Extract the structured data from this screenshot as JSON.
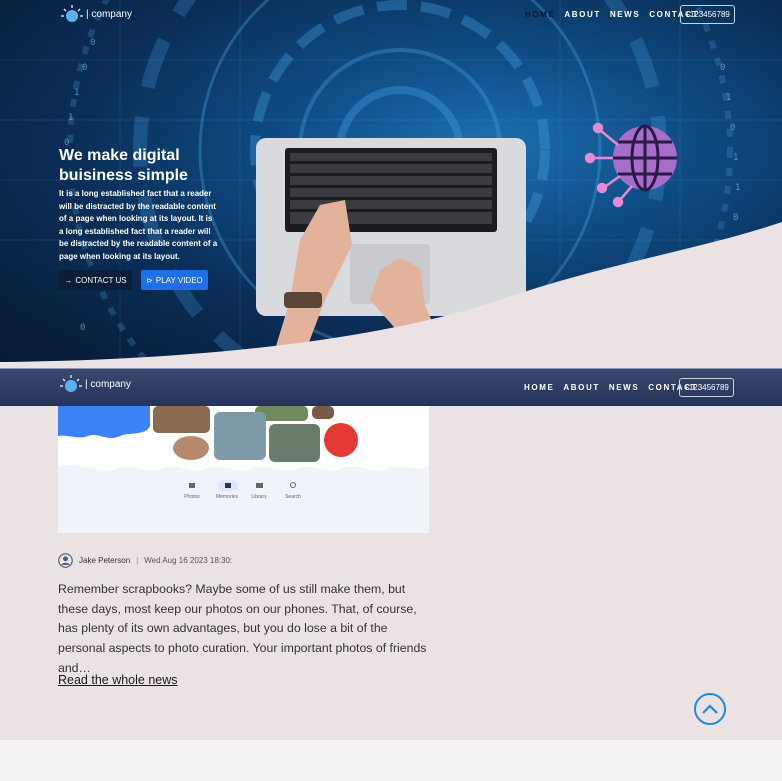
{
  "brand": {
    "name": "| company",
    "logo_icon": "company-logo-icon"
  },
  "nav": {
    "links": [
      "HOME",
      "ABOUT",
      "NEWS",
      "CONTACT"
    ],
    "phone": "+123456789"
  },
  "hero": {
    "title": "We make digital buisiness simple",
    "text": "It is a long established fact that a reader will be distracted by the readable content of a page when looking at its layout. It is a long established fact that a reader will be distracted by the readable content of a page when looking at its layout.",
    "contact_label": "CONTACT US",
    "video_label": "PLAY VIDEO"
  },
  "article": {
    "thumbnail_tabs": [
      "Photos",
      "Memories",
      "Library",
      "Search"
    ],
    "author": "Jake Peterson",
    "date": "Wed Aug 16 2023 18:30:",
    "excerpt": "Remember scrapbooks? Maybe some of us still make them, but these days, most keep our photos on our phones. That, of course, has plenty of its own advantages, but you do lose a bit of the personal aspects to photo curation. Your important photos of friends and…",
    "read_more": "Read the whole news"
  },
  "colors": {
    "accent": "#1f6fe8",
    "nav_bg": "#2b375d",
    "page_bg": "#ebe3e3",
    "scroll_top": "#1b8cde"
  }
}
